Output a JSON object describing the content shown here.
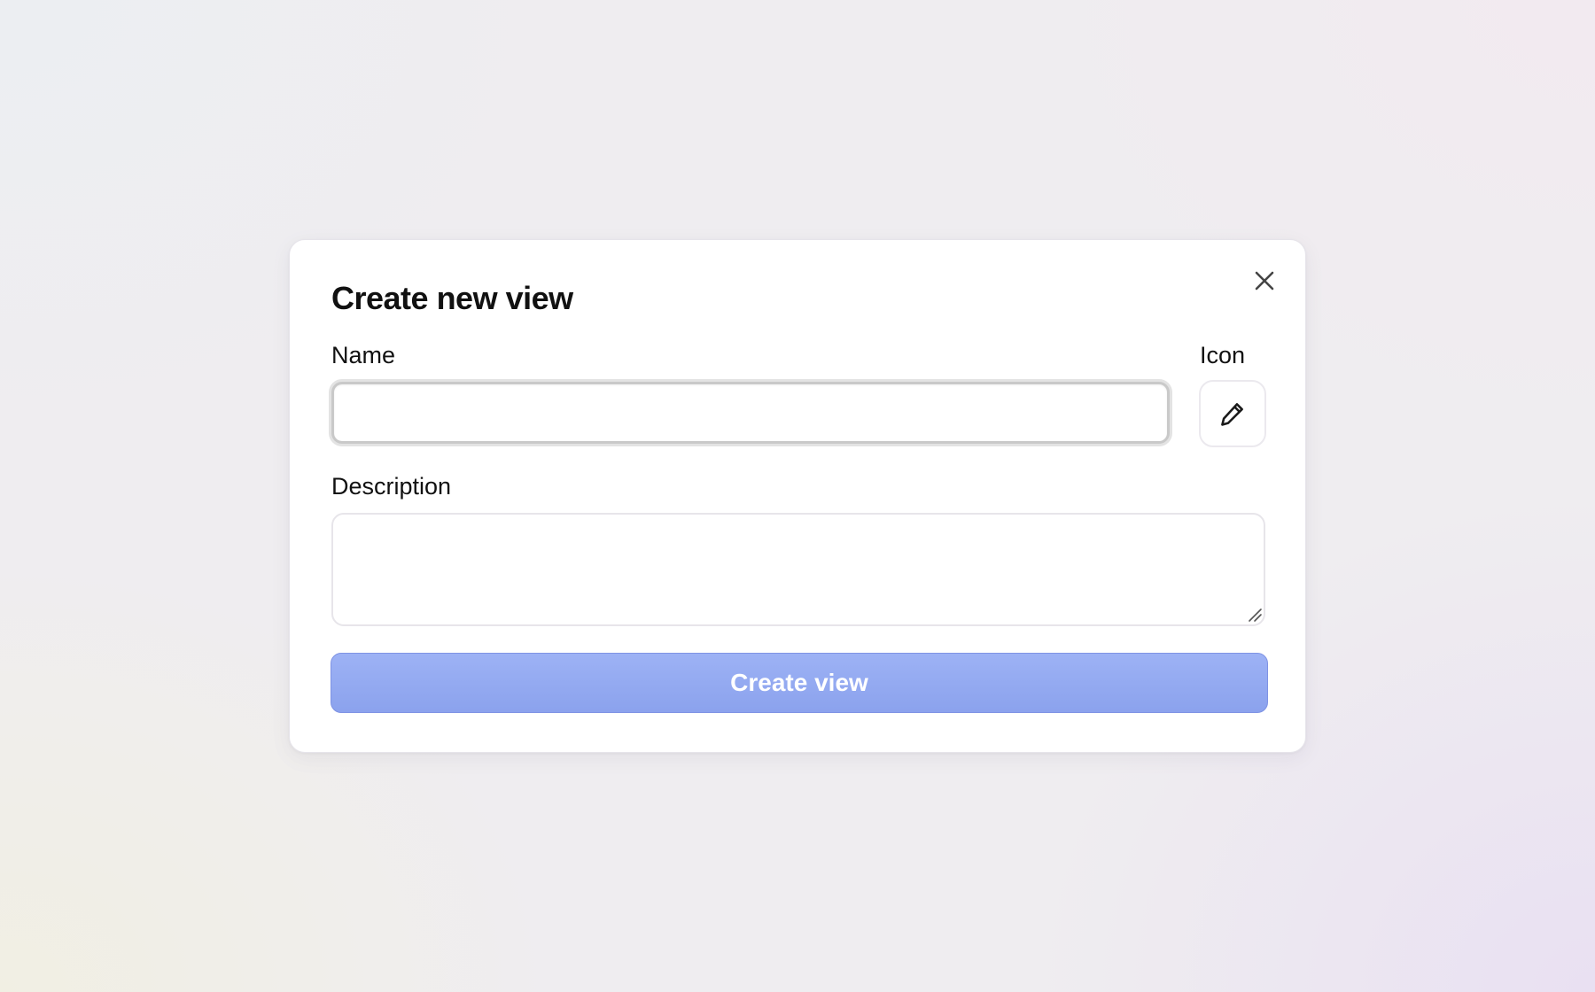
{
  "dialog": {
    "title": "Create new view",
    "close_icon": "close-icon",
    "name_label": "Name",
    "name_value": "",
    "icon_label": "Icon",
    "icon_button_icon": "pencil-icon",
    "description_label": "Description",
    "description_value": "",
    "submit_label": "Create view"
  },
  "colors": {
    "accent": "#8ba2ed",
    "accent_border": "#7f93e4",
    "text": "#111111",
    "background": "#efedf0"
  }
}
